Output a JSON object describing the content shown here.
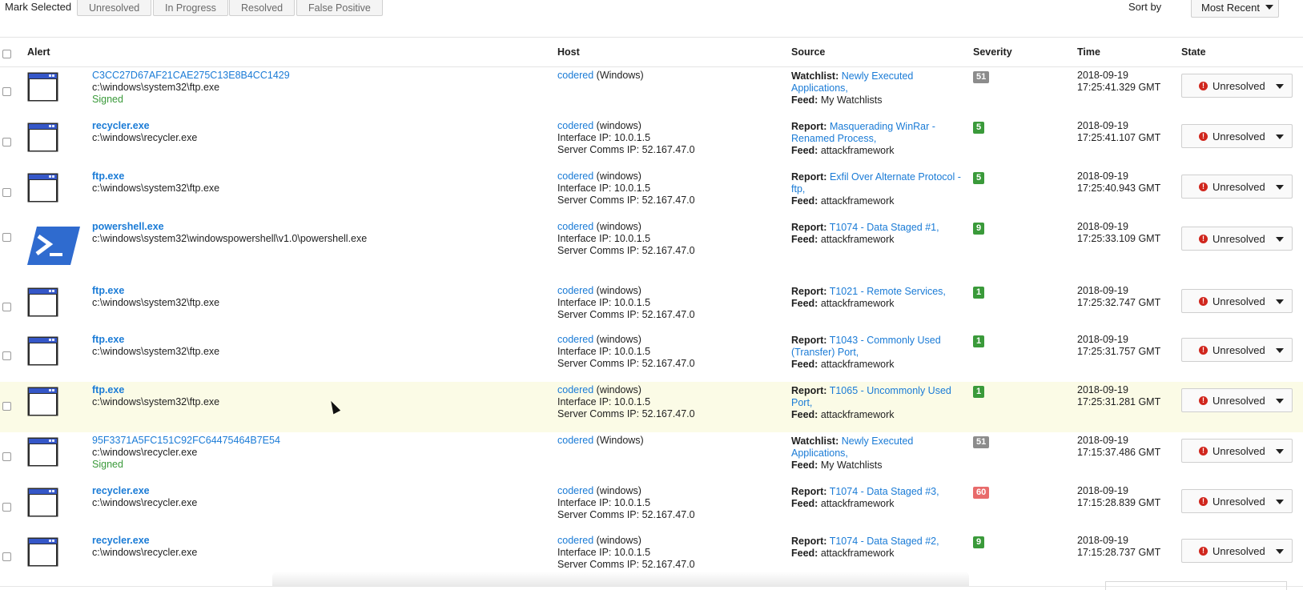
{
  "toolbar": {
    "mark_selected_label": "Mark Selected",
    "buttons": [
      "Unresolved",
      "In Progress",
      "Resolved",
      "False Positive"
    ],
    "sort_label": "Sort by",
    "sort_value": "Most Recent"
  },
  "columns": {
    "alert": "Alert",
    "host": "Host",
    "source": "Source",
    "severity": "Severity",
    "time": "Time",
    "state": "State"
  },
  "colors": {
    "link": "#1a7bd6",
    "severity_green": "#3a9a3a",
    "severity_grey": "#8c8c8c",
    "severity_red": "#e86b6b",
    "highlight_row": "#fbfbe6",
    "alert_red": "#d0261d"
  },
  "rows": [
    {
      "icon": "window-app-icon",
      "title": "C3CC27D67AF21CAE275C13E8B4CC1429",
      "title_bold": false,
      "path": "c:\\windows\\system32\\ftp.exe",
      "signed": "Signed",
      "host_link": "codered",
      "host_os": "(Windows)",
      "interface_ip": "",
      "server_ip": "",
      "source_kind": "Watchlist:",
      "source_line1": "Newly Executed",
      "source_line2": "Applications,",
      "feed_label": "Feed:",
      "feed_value": "My Watchlists",
      "severity": "51",
      "severity_color": "#8c8c8c",
      "date": "2018-09-19",
      "time": "17:25:41.329 GMT",
      "state": "Unresolved"
    },
    {
      "icon": "window-app-icon",
      "title": "recycler.exe",
      "title_bold": true,
      "path": "c:\\windows\\recycler.exe",
      "signed": "",
      "host_link": "codered",
      "host_os": "(windows)",
      "interface_ip": "Interface IP: 10.0.1.5",
      "server_ip": "Server Comms IP: 52.167.47.0",
      "source_kind": "Report:",
      "source_line1": "Masquerading WinRar -",
      "source_line2": "Renamed Process,",
      "feed_label": "Feed:",
      "feed_value": "attackframework",
      "severity": "5",
      "severity_color": "#3a9a3a",
      "date": "2018-09-19",
      "time": "17:25:41.107 GMT",
      "state": "Unresolved"
    },
    {
      "icon": "window-app-icon",
      "title": "ftp.exe",
      "title_bold": true,
      "path": "c:\\windows\\system32\\ftp.exe",
      "signed": "",
      "host_link": "codered",
      "host_os": "(windows)",
      "interface_ip": "Interface IP: 10.0.1.5",
      "server_ip": "Server Comms IP: 52.167.47.0",
      "source_kind": "Report:",
      "source_line1": "Exfil Over Alternate Protocol -",
      "source_line2": "ftp,",
      "feed_label": "Feed:",
      "feed_value": "attackframework",
      "severity": "5",
      "severity_color": "#3a9a3a",
      "date": "2018-09-19",
      "time": "17:25:40.943 GMT",
      "state": "Unresolved"
    },
    {
      "icon": "powershell-icon",
      "title": "powershell.exe",
      "title_bold": true,
      "path": "c:\\windows\\system32\\windowspowershell\\v1.0\\powershell.exe",
      "signed": "",
      "host_link": "codered",
      "host_os": "(windows)",
      "interface_ip": "Interface IP: 10.0.1.5",
      "server_ip": "Server Comms IP: 52.167.47.0",
      "source_kind": "Report:",
      "source_line1": "T1074 - Data Staged #1,",
      "source_line2": "",
      "feed_label": "Feed:",
      "feed_value": "attackframework",
      "severity": "9",
      "severity_color": "#3a9a3a",
      "date": "2018-09-19",
      "time": "17:25:33.109 GMT",
      "state": "Unresolved"
    },
    {
      "icon": "window-app-icon",
      "title": "ftp.exe",
      "title_bold": true,
      "path": "c:\\windows\\system32\\ftp.exe",
      "signed": "",
      "host_link": "codered",
      "host_os": "(windows)",
      "interface_ip": "Interface IP: 10.0.1.5",
      "server_ip": "Server Comms IP: 52.167.47.0",
      "source_kind": "Report:",
      "source_line1": "T1021 - Remote Services,",
      "source_line2": "",
      "feed_label": "Feed:",
      "feed_value": "attackframework",
      "severity": "1",
      "severity_color": "#3a9a3a",
      "date": "2018-09-19",
      "time": "17:25:32.747 GMT",
      "state": "Unresolved"
    },
    {
      "icon": "window-app-icon",
      "title": "ftp.exe",
      "title_bold": true,
      "path": "c:\\windows\\system32\\ftp.exe",
      "signed": "",
      "host_link": "codered",
      "host_os": "(windows)",
      "interface_ip": "Interface IP: 10.0.1.5",
      "server_ip": "Server Comms IP: 52.167.47.0",
      "source_kind": "Report:",
      "source_line1": "T1043 - Commonly Used",
      "source_line2": "(Transfer) Port,",
      "feed_label": "Feed:",
      "feed_value": "attackframework",
      "severity": "1",
      "severity_color": "#3a9a3a",
      "date": "2018-09-19",
      "time": "17:25:31.757 GMT",
      "state": "Unresolved"
    },
    {
      "icon": "window-app-icon",
      "title": "ftp.exe",
      "title_bold": true,
      "path": "c:\\windows\\system32\\ftp.exe",
      "signed": "",
      "host_link": "codered",
      "host_os": "(windows)",
      "interface_ip": "Interface IP: 10.0.1.5",
      "server_ip": "Server Comms IP: 52.167.47.0",
      "source_kind": "Report:",
      "source_line1": "T1065 - Uncommonly Used",
      "source_line2": "Port,",
      "feed_label": "Feed:",
      "feed_value": "attackframework",
      "severity": "1",
      "severity_color": "#3a9a3a",
      "date": "2018-09-19",
      "time": "17:25:31.281 GMT",
      "state": "Unresolved",
      "highlight": true
    },
    {
      "icon": "window-app-icon",
      "title": "95F3371A5FC151C92FC64475464B7E54",
      "title_bold": false,
      "path": "c:\\windows\\recycler.exe",
      "signed": "Signed",
      "host_link": "codered",
      "host_os": "(Windows)",
      "interface_ip": "",
      "server_ip": "",
      "source_kind": "Watchlist:",
      "source_line1": "Newly Executed",
      "source_line2": "Applications,",
      "feed_label": "Feed:",
      "feed_value": "My Watchlists",
      "severity": "51",
      "severity_color": "#8c8c8c",
      "date": "2018-09-19",
      "time": "17:15:37.486 GMT",
      "state": "Unresolved"
    },
    {
      "icon": "window-app-icon",
      "title": "recycler.exe",
      "title_bold": true,
      "path": "c:\\windows\\recycler.exe",
      "signed": "",
      "host_link": "codered",
      "host_os": "(windows)",
      "interface_ip": "Interface IP: 10.0.1.5",
      "server_ip": "Server Comms IP: 52.167.47.0",
      "source_kind": "Report:",
      "source_line1": "T1074 - Data Staged #3,",
      "source_line2": "",
      "feed_label": "Feed:",
      "feed_value": "attackframework",
      "severity": "60",
      "severity_color": "#e86b6b",
      "date": "2018-09-19",
      "time": "17:15:28.839 GMT",
      "state": "Unresolved"
    },
    {
      "icon": "window-app-icon",
      "title": "recycler.exe",
      "title_bold": true,
      "path": "c:\\windows\\recycler.exe",
      "signed": "",
      "host_link": "codered",
      "host_os": "(windows)",
      "interface_ip": "Interface IP: 10.0.1.5",
      "server_ip": "Server Comms IP: 52.167.47.0",
      "source_kind": "Report:",
      "source_line1": "T1074 - Data Staged #2,",
      "source_line2": "",
      "feed_label": "Feed:",
      "feed_value": "attackframework",
      "severity": "9",
      "severity_color": "#3a9a3a",
      "date": "2018-09-19",
      "time": "17:15:28.737 GMT",
      "state": "Unresolved"
    }
  ]
}
